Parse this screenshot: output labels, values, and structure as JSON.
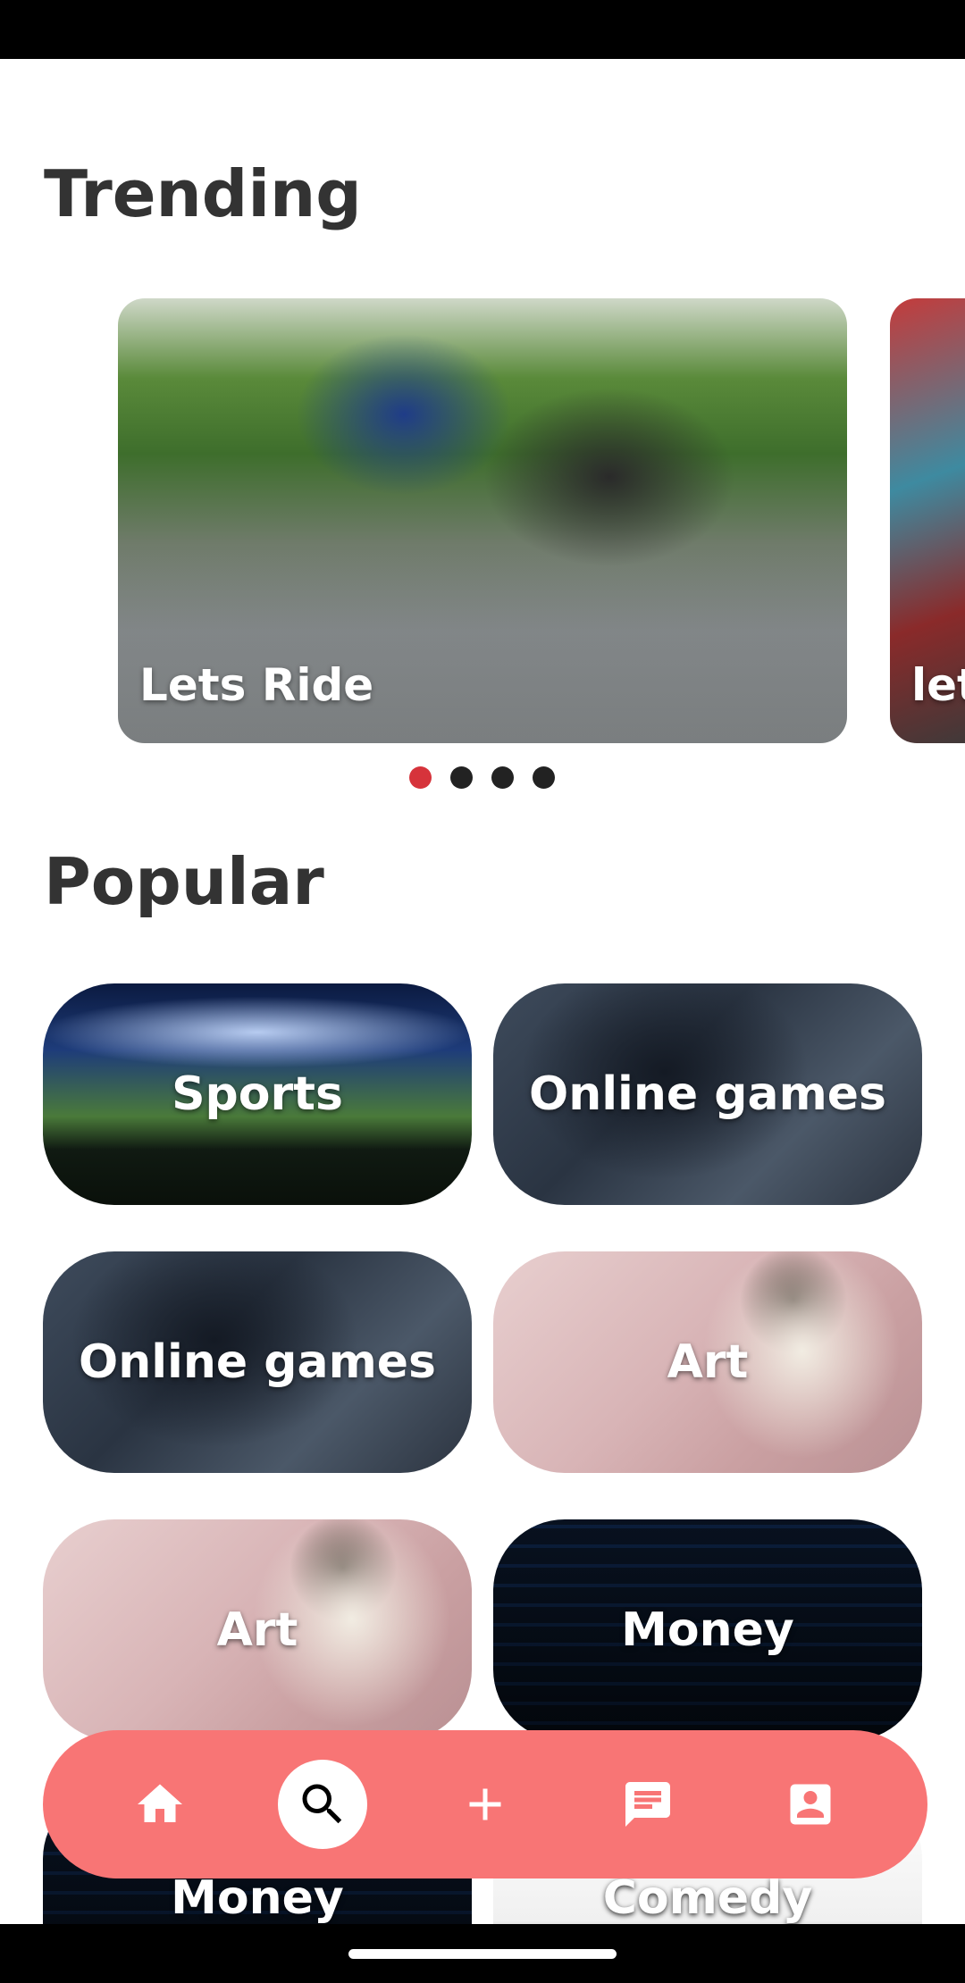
{
  "sections": {
    "trending_title": "Trending",
    "popular_title": "Popular"
  },
  "trending": {
    "cards": [
      {
        "label": "Lets Ride"
      },
      {
        "label": "let"
      }
    ],
    "dots": {
      "count": 4,
      "active_index": 0
    }
  },
  "popular": {
    "tiles": [
      {
        "label": "Sports"
      },
      {
        "label": "Online games"
      },
      {
        "label": "Online games"
      },
      {
        "label": "Art"
      },
      {
        "label": "Art"
      },
      {
        "label": "Money"
      },
      {
        "label": "Money"
      },
      {
        "label": "Comedy"
      }
    ]
  },
  "bottom_nav": {
    "items": [
      "home-icon",
      "search-icon",
      "add-icon",
      "chat-icon",
      "profile-icon"
    ],
    "active": "search-icon"
  },
  "colors": {
    "accent": "#f87575",
    "dot_active": "#d6333b",
    "title_text": "#333333"
  }
}
